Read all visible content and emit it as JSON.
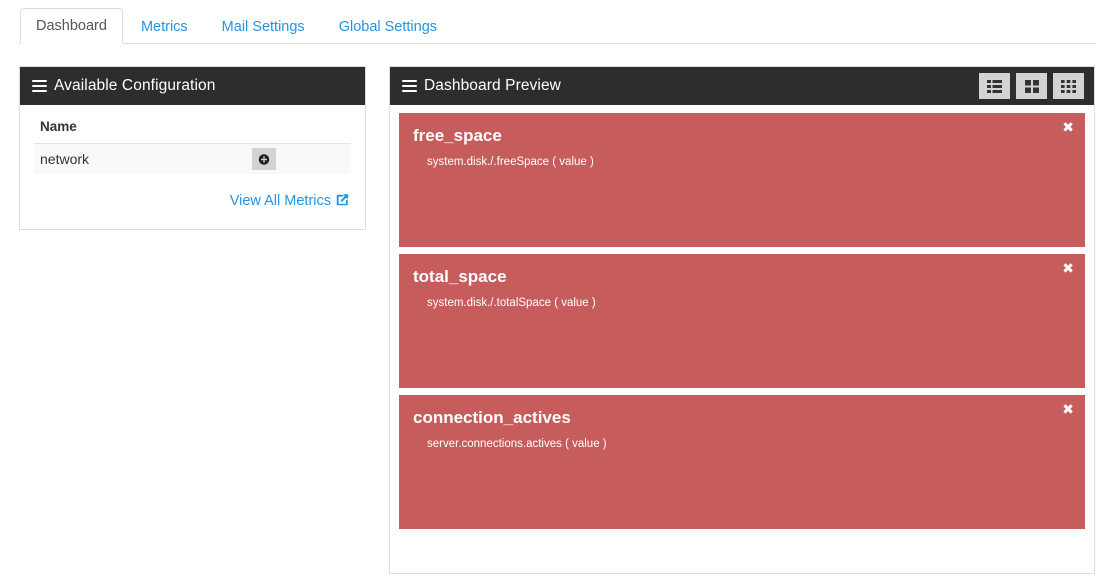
{
  "tabs": [
    {
      "label": "Dashboard",
      "active": true
    },
    {
      "label": "Metrics",
      "active": false
    },
    {
      "label": "Mail Settings",
      "active": false
    },
    {
      "label": "Global Settings",
      "active": false
    }
  ],
  "left_panel": {
    "title": "Available Configuration",
    "menu_icon": "hamburger-icon",
    "table": {
      "columns": [
        "Name"
      ],
      "rows": [
        {
          "name": "network",
          "action_icon": "plus-circle-icon"
        }
      ]
    },
    "view_all_link": "View All Metrics",
    "view_all_icon": "external-link-square-icon"
  },
  "right_panel": {
    "title": "Dashboard Preview",
    "menu_icon": "hamburger-icon",
    "view_buttons": [
      {
        "name": "list-view",
        "icon": "th-list-icon"
      },
      {
        "name": "large-grid-view",
        "icon": "th-large-icon"
      },
      {
        "name": "grid-view",
        "icon": "th-icon"
      }
    ],
    "widgets": [
      {
        "title": "free_space",
        "metric": "system.disk./.freeSpace ( value )",
        "close_icon": "close-icon"
      },
      {
        "title": "total_space",
        "metric": "system.disk./.totalSpace ( value )",
        "close_icon": "close-icon"
      },
      {
        "title": "connection_actives",
        "metric": "server.connections.actives ( value )",
        "close_icon": "close-icon"
      }
    ]
  },
  "colors": {
    "panel_header": "#2d2d2d",
    "widget": "#c65c5c",
    "link": "#2196e3",
    "button": "#d3d3d3"
  }
}
